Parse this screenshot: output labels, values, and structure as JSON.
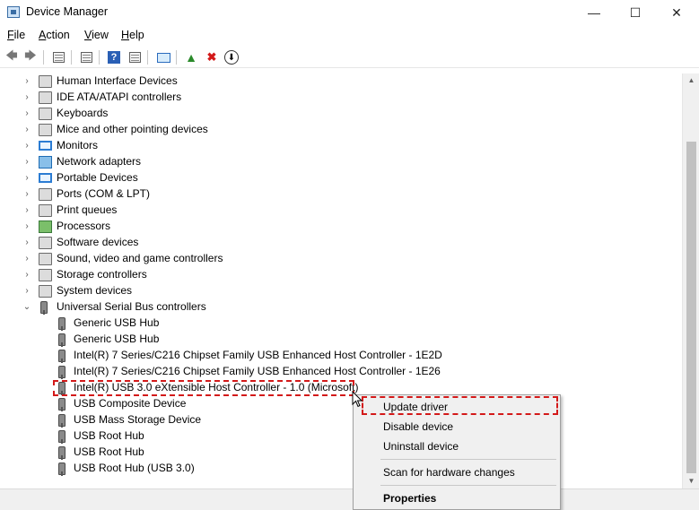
{
  "window": {
    "title": "Device Manager",
    "minimize": "—",
    "maximize": "☐",
    "close": "✕"
  },
  "menu": {
    "file_u": "F",
    "file_rest": "ile",
    "action_u": "A",
    "action_rest": "ction",
    "view_u": "V",
    "view_rest": "iew",
    "help_u": "H",
    "help_rest": "elp"
  },
  "toolbar": {
    "back": "🡄",
    "forward": "🡆",
    "uninstall": "✖",
    "update": "⬇"
  },
  "colors": {
    "accent_red": "#d31919",
    "help_blue": "#2a5fb5"
  },
  "tree": {
    "categories": [
      "Human Interface Devices",
      "IDE ATA/ATAPI controllers",
      "Keyboards",
      "Mice and other pointing devices",
      "Monitors",
      "Network adapters",
      "Portable Devices",
      "Ports (COM & LPT)",
      "Print queues",
      "Processors",
      "Software devices",
      "Sound, video and game controllers",
      "Storage controllers",
      "System devices",
      "Universal Serial Bus controllers"
    ],
    "usb_children": [
      "Generic USB Hub",
      "Generic USB Hub",
      "Intel(R) 7 Series/C216 Chipset Family USB Enhanced Host Controller - 1E2D",
      "Intel(R) 7 Series/C216 Chipset Family USB Enhanced Host Controller - 1E26",
      "Intel(R) USB 3.0 eXtensible Host Controller - 1.0 (Microsoft)",
      "USB Composite Device",
      "USB Mass Storage Device",
      "USB Root Hub",
      "USB Root Hub",
      "USB Root Hub (USB 3.0)"
    ]
  },
  "context_menu": {
    "update_driver": "Update driver",
    "disable_device": "Disable device",
    "uninstall_device": "Uninstall device",
    "scan": "Scan for hardware changes",
    "properties": "Properties"
  }
}
